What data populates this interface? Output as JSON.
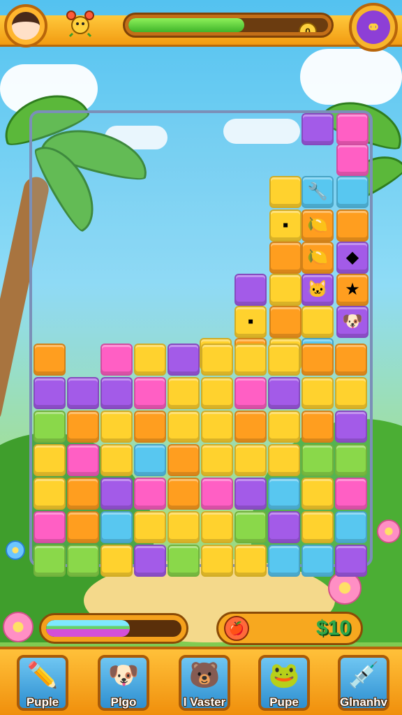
{
  "hud": {
    "avatar_icon": "girl-avatar-icon",
    "pet_icon": "crab-icon",
    "xp_fill_fraction": 0.58,
    "xp_value": "0",
    "menu_icon": "link-icon"
  },
  "board": {
    "tiles": [
      {
        "c": "p",
        "icon": ""
      },
      {
        "c": "k",
        "icon": ""
      },
      {
        "c": "y",
        "icon": ""
      },
      {
        "c": "b",
        "icon": "🔧"
      },
      {
        "c": "b",
        "icon": ""
      },
      {
        "c": "k",
        "icon": ""
      },
      {
        "c": "o",
        "icon": "🍋"
      },
      {
        "c": "o",
        "icon": ""
      },
      {
        "c": "p",
        "icon": "◆"
      },
      {
        "c": "o",
        "icon": ""
      },
      {
        "c": "o",
        "icon": "🍋"
      },
      {
        "c": "y",
        "icon": "▪"
      },
      {
        "c": "p",
        "icon": ""
      },
      {
        "c": "y",
        "icon": ""
      },
      {
        "c": "p",
        "icon": "🐱"
      },
      {
        "c": "o",
        "icon": "★"
      },
      {
        "c": "y",
        "icon": "▪"
      },
      {
        "c": "o",
        "icon": ""
      },
      {
        "c": "y",
        "icon": ""
      },
      {
        "c": "p",
        "icon": "🐶"
      },
      {
        "c": "y",
        "icon": ""
      },
      {
        "c": "o",
        "icon": "♥"
      },
      {
        "c": "y",
        "icon": ""
      },
      {
        "c": "b",
        "icon": "🍃"
      }
    ],
    "rows": [
      [
        "o",
        "",
        "k",
        "y",
        "p",
        "y",
        "y",
        "y",
        "o",
        "o"
      ],
      [
        "p",
        "p",
        "p",
        "k",
        "y",
        "y",
        "k",
        "p",
        "y",
        "y"
      ],
      [
        "g",
        "o",
        "y",
        "o",
        "y",
        "y",
        "o",
        "y",
        "o",
        "p"
      ],
      [
        "y",
        "k",
        "y",
        "b",
        "o",
        "y",
        "y",
        "y",
        "g",
        "g"
      ],
      [
        "y",
        "o",
        "p",
        "k",
        "o",
        "k",
        "p",
        "b",
        "y",
        "k"
      ],
      [
        "k",
        "o",
        "b",
        "y",
        "y",
        "y",
        "g",
        "p",
        "y",
        "b"
      ],
      [
        "g",
        "g",
        "y",
        "p",
        "g",
        "y",
        "y",
        "b",
        "b",
        "p"
      ]
    ]
  },
  "bottom": {
    "energy_fill_fraction": 0.62,
    "coin_icon": "apple-icon",
    "coin_value": "$10"
  },
  "dock": {
    "buttons": [
      {
        "label": "Puple",
        "icon": "pencil-icon"
      },
      {
        "label": "Plgo",
        "icon": "dog-icon"
      },
      {
        "label": "l Vaster",
        "icon": "bear-icon"
      },
      {
        "label": "Pupe",
        "icon": "frog-icon"
      },
      {
        "label": "Glnanhv",
        "icon": "syringe-icon"
      }
    ]
  }
}
